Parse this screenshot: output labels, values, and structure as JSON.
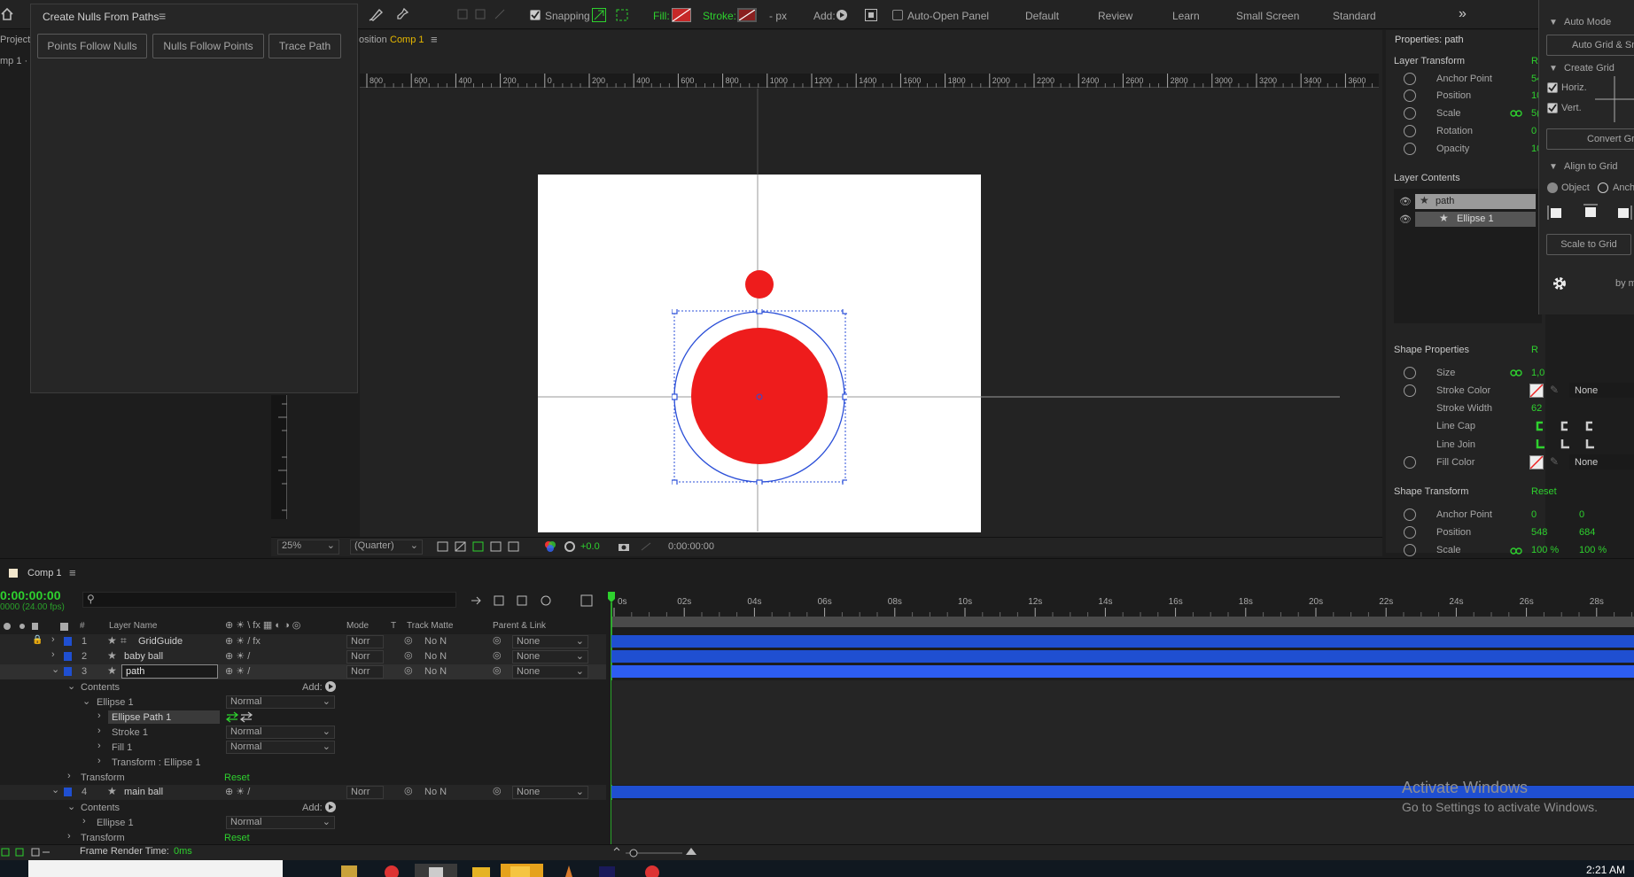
{
  "toolbar": {
    "snapping": "Snapping",
    "fill_label": "Fill:",
    "stroke_label": "Stroke:",
    "stroke_unit": "- px",
    "add_label": "Add:",
    "auto_open": "Auto-Open Panel",
    "workspaces": [
      "Default",
      "Review",
      "Learn",
      "Small Screen",
      "Standard"
    ],
    "more": "»"
  },
  "nulls_panel": {
    "title": "Create Nulls From Paths",
    "menu": "≡",
    "buttons": [
      "Points Follow Nulls",
      "Nulls Follow Points",
      "Trace Path"
    ]
  },
  "project_tab": "Project",
  "project_comp": "mp 1 ·",
  "comp_tab": {
    "prefix": "osition",
    "name": "Comp 1",
    "menu": "≡"
  },
  "ruler": {
    "labels": [
      "800",
      "600",
      "400",
      "200",
      "0",
      "200",
      "400",
      "600",
      "800",
      "1000",
      "1200",
      "1400",
      "1600",
      "1800",
      "2000",
      "2200",
      "2400",
      "2600",
      "2800",
      "3000",
      "3200",
      "3400",
      "3600"
    ]
  },
  "comp_footer": {
    "zoom": "25%",
    "quality": "(Quarter)",
    "exposure": "+0.0",
    "timecode": "0:00:00:00"
  },
  "properties": {
    "title": "Properties: path",
    "layer_transform": "Layer Transform",
    "lt_reset": "R",
    "lt_rows": [
      {
        "label": "Anchor Point",
        "value": "54"
      },
      {
        "label": "Position",
        "value": "10"
      },
      {
        "label": "Scale",
        "value": "5("
      },
      {
        "label": "Rotation",
        "value": "0"
      },
      {
        "label": "Opacity",
        "value": "10"
      }
    ],
    "layer_contents": "Layer Contents",
    "contents": [
      "path",
      "Ellipse 1"
    ],
    "shape_properties": "Shape Properties",
    "sp_reset": "R",
    "sp_rows": [
      {
        "label": "Size",
        "value": "1,0"
      },
      {
        "label": "Stroke Color",
        "value": "None"
      },
      {
        "label": "Stroke Width",
        "value": "62"
      },
      {
        "label": "Line Cap",
        "value": ""
      },
      {
        "label": "Line Join",
        "value": ""
      },
      {
        "label": "Fill Color",
        "value": "None"
      }
    ],
    "shape_transform": "Shape Transform",
    "st_reset": "Reset",
    "st_rows": [
      {
        "label": "Anchor Point",
        "v1": "0",
        "v2": "0"
      },
      {
        "label": "Position",
        "v1": "548",
        "v2": "684"
      },
      {
        "label": "Scale",
        "v1": "100 %",
        "v2": "100 %"
      }
    ]
  },
  "gridguide": {
    "auto_mode": "Auto Mode",
    "auto_grid": "Auto Grid & Sn",
    "create_grid": "Create Grid",
    "horiz": "Horiz.",
    "vert": "Vert.",
    "convert": "Convert Gr",
    "align_to_grid": "Align to Grid",
    "object": "Object",
    "anchor": "Anch",
    "scale_to_grid": "Scale to Grid",
    "by": "by m"
  },
  "timeline": {
    "tab": "Comp 1",
    "menu": "≡",
    "timecode": "0:00:00:00",
    "fps": "0000 (24.00 fps)",
    "search_placeholder": "",
    "col_headers": {
      "num": "#",
      "name": "Layer Name",
      "mode": "Mode",
      "t": "T",
      "track": "Track Matte",
      "parent": "Parent & Link"
    },
    "ticks": [
      "0s",
      "02s",
      "04s",
      "06s",
      "08s",
      "10s",
      "12s",
      "14s",
      "16s",
      "18s",
      "20s",
      "22s",
      "24s",
      "26s",
      "28s"
    ],
    "layers": [
      {
        "num": "1",
        "name": "GridGuide",
        "mode": "Norr",
        "track": "No N",
        "parent": "None"
      },
      {
        "num": "2",
        "name": "baby ball",
        "mode": "Norr",
        "track": "No N",
        "parent": "None"
      },
      {
        "num": "3",
        "name": "path",
        "mode": "Norr",
        "track": "No N",
        "parent": "None"
      },
      {
        "num": "4",
        "name": "main ball",
        "mode": "Norr",
        "track": "No N",
        "parent": "None"
      }
    ],
    "contents": "Contents",
    "add": "Add:",
    "ellipse1": "Ellipse 1",
    "ellipse_path": "Ellipse Path 1",
    "stroke1": "Stroke 1",
    "fill1": "Fill 1",
    "transform_ellipse": "Transform : Ellipse 1",
    "transform": "Transform",
    "reset": "Reset",
    "normal": "Normal",
    "frame_render": "Frame Render Time:",
    "frame_render_val": "0ms"
  },
  "watermark": {
    "line1": "Activate Windows",
    "line2": "Go to Settings to activate Windows."
  },
  "taskbar": {
    "time": "2:21 AM"
  },
  "colors": {
    "accent_green": "#2ed12e",
    "layer_blue": "#1f4fd1",
    "ball_red": "#ee1c1c",
    "path_blue": "#2b4fd8"
  }
}
